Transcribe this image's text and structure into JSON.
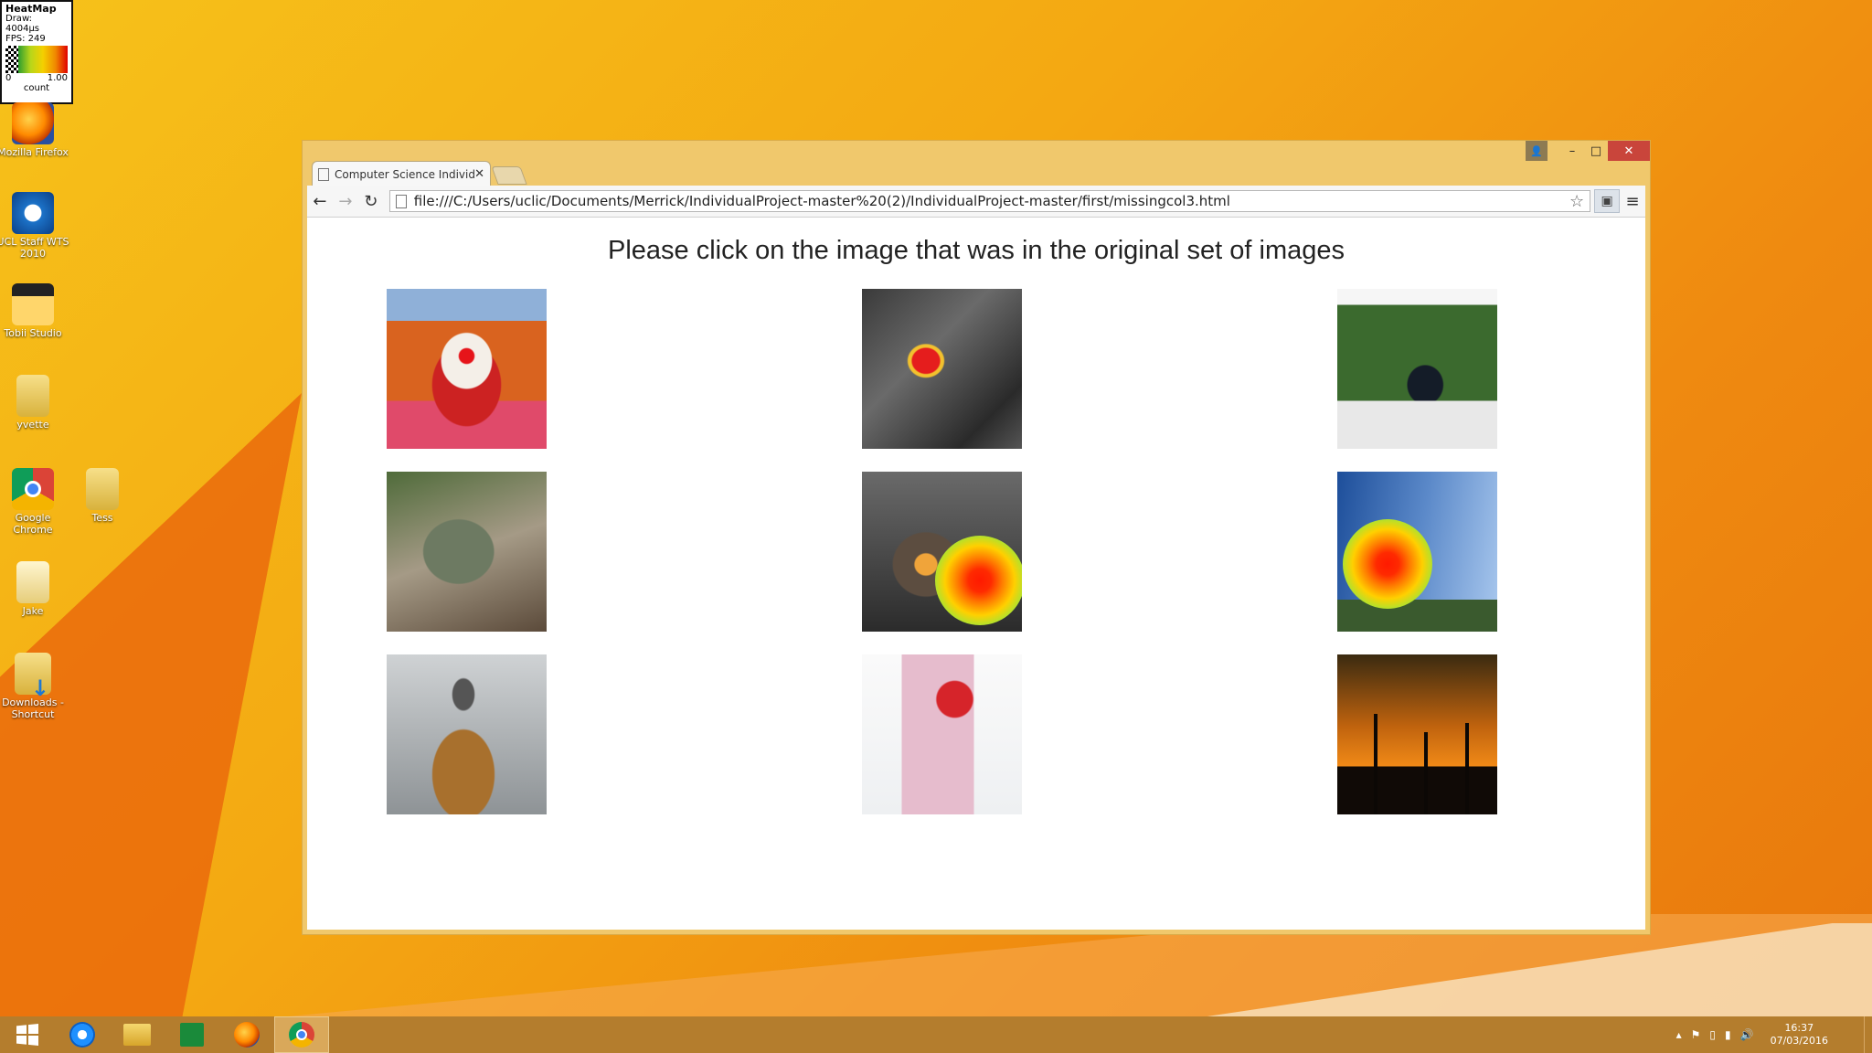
{
  "heatmap_legend": {
    "title": "HeatMap",
    "draw": "Draw: 4004µs",
    "fps": "FPS: 249",
    "min": "0",
    "max": "1.00",
    "unit": "count"
  },
  "desktop_icons": [
    {
      "label": "Mozilla Firefox",
      "icon": "firefox-icon"
    },
    {
      "label": "UCL Staff WTS 2010",
      "icon": "remote-desktop-icon"
    },
    {
      "label": "Tobii Studio",
      "icon": "tobii-studio-icon"
    },
    {
      "label": "yvette",
      "icon": "folder-icon"
    },
    {
      "label": "Google Chrome",
      "icon": "chrome-icon"
    },
    {
      "label": "Tess",
      "icon": "folder-icon"
    },
    {
      "label": "Jake",
      "icon": "document-icon"
    },
    {
      "label": "Downloads - Shortcut",
      "icon": "downloads-shortcut-icon"
    }
  ],
  "browser": {
    "tab_title": "Computer Science Individ",
    "url": "file:///C:/Users/uclic/Documents/Merrick/IndividualProject-master%20(2)/IndividualProject-master/first/missingcol3.html",
    "window_controls": {
      "minimize": "–",
      "maximize": "□",
      "close": "✕"
    }
  },
  "page": {
    "heading": "Please click on the image that was in the original set of images",
    "images": [
      {
        "subject": "clown"
      },
      {
        "subject": "helicopter"
      },
      {
        "subject": "police officer"
      },
      {
        "subject": "dinosaur"
      },
      {
        "subject": "light bulb",
        "gaze_heat": 1.0
      },
      {
        "subject": "eiffel tower",
        "gaze_heat": 1.0
      },
      {
        "subject": "person in hat"
      },
      {
        "subject": "strawberry smoothie"
      },
      {
        "subject": "sunset trees"
      }
    ]
  },
  "taskbar": {
    "pinned": [
      "start-icon",
      "internet-explorer-icon",
      "file-explorer-icon",
      "store-icon",
      "firefox-icon",
      "chrome-icon"
    ],
    "active": "chrome-icon",
    "time": "16:37",
    "date": "07/03/2016"
  }
}
